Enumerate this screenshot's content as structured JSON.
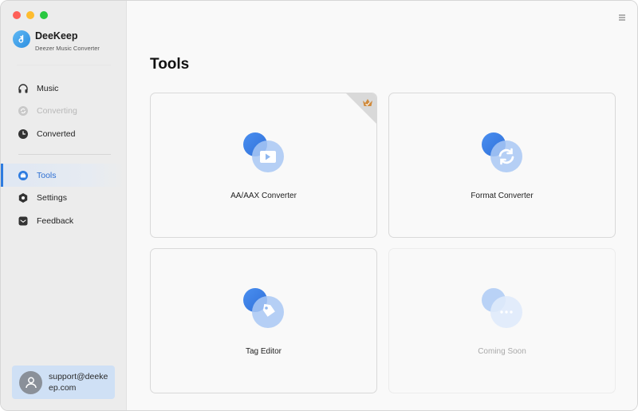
{
  "window": {
    "traffic_colors": [
      "#fe5f57",
      "#febc2e",
      "#28c840"
    ]
  },
  "brand": {
    "name": "DeeKeep",
    "subtitle": "Deezer Music Converter"
  },
  "sidebar": {
    "items": [
      {
        "label": "Music",
        "icon": "headphones-icon",
        "state": "normal"
      },
      {
        "label": "Converting",
        "icon": "converting-icon",
        "state": "disabled"
      },
      {
        "label": "Converted",
        "icon": "clock-icon",
        "state": "normal"
      },
      {
        "label": "Tools",
        "icon": "toolbox-icon",
        "state": "active"
      },
      {
        "label": "Settings",
        "icon": "gear-icon",
        "state": "normal"
      },
      {
        "label": "Feedback",
        "icon": "mail-icon",
        "state": "normal"
      }
    ],
    "support_email": "support@deekeep.com"
  },
  "main": {
    "title": "Tools",
    "tools": [
      {
        "label": "AA/AAX Converter",
        "icon": "video-convert-icon",
        "premium": true
      },
      {
        "label": "Format Converter",
        "icon": "refresh-icon",
        "premium": false
      },
      {
        "label": "Tag Editor",
        "icon": "tag-icon",
        "premium": false
      },
      {
        "label": "Coming Soon",
        "icon": "more-icon",
        "premium": false,
        "disabled": true
      }
    ]
  },
  "colors": {
    "accent": "#2e7ce0",
    "active_bg": "#dfe7f3",
    "support_bg": "#cfe0f5"
  }
}
